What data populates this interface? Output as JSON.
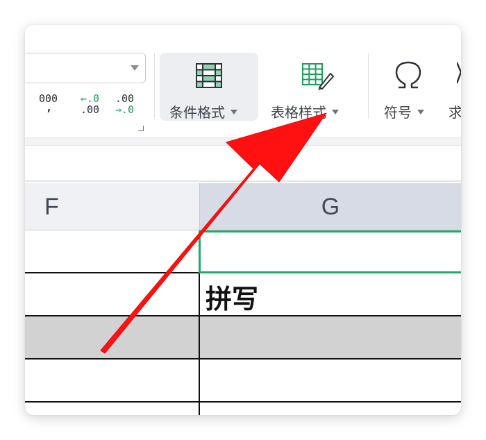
{
  "ribbon": {
    "number_format_combo": {
      "value": ""
    },
    "thousands_button": {
      "label": "000",
      "sub": ","
    },
    "increase_decimal": {
      "top": "←.0",
      "bottom": ".00"
    },
    "decrease_decimal": {
      "top": ".00",
      "bottom": "→.0"
    },
    "conditional_format": {
      "label": "条件格式"
    },
    "table_style": {
      "label": "表格样式"
    },
    "symbol": {
      "label": "符号"
    },
    "next_partial": {
      "label": "求"
    }
  },
  "sheet": {
    "columns": [
      {
        "label": "F",
        "selected": false
      },
      {
        "label": "G",
        "selected": true
      }
    ],
    "rows": [
      {
        "g_value": ""
      },
      {
        "g_value": "拼写"
      },
      {
        "g_value": "",
        "shaded": true
      },
      {
        "g_value": ""
      }
    ]
  },
  "colors": {
    "accent_green": "#1faa66",
    "arrow_red": "#ff1111",
    "shaded_row": "#d2d2d2"
  }
}
